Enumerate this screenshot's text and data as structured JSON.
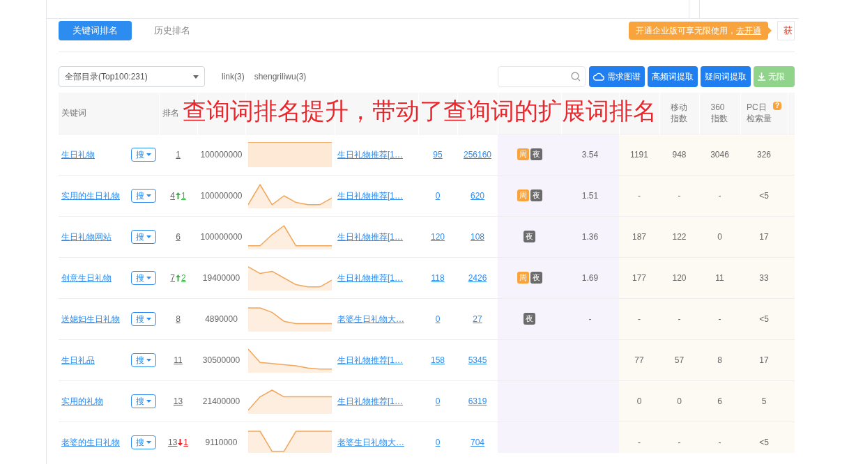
{
  "tabs": [
    {
      "label": "关键词排名",
      "selected": true
    },
    {
      "label": "历史排名",
      "selected": false
    }
  ],
  "promo": {
    "text": "开通企业版可享无限使用，",
    "link": "去开通"
  },
  "promo_side_button": "获",
  "category_select": "全部目录(Top100:231)",
  "filter_links": [
    "link(3)",
    "shengriliwu(3)"
  ],
  "toolbar_buttons": [
    {
      "label": "需求图谱",
      "kind": "graph"
    },
    {
      "label": "高频词提取",
      "kind": "plain"
    },
    {
      "label": "疑问词提取",
      "kind": "plain"
    },
    {
      "label": "无限",
      "kind": "download"
    }
  ],
  "header": {
    "keyword": "关键词",
    "rank": "排名",
    "mobile_index": "移动指数",
    "index_360": "360指数",
    "pc_daily": "PC日检索量",
    "pc_daily_help": "?"
  },
  "caption": "查询词排名提升，带动了查询词的扩展词排名",
  "rows": [
    {
      "keyword": "生日礼物",
      "search_button": "搜",
      "rank": "1",
      "index": "100000000",
      "title": "生日礼物推荐[1…",
      "column_6": "95",
      "column_7": "256160",
      "tags": [
        {
          "label": "周",
          "kind": "week"
        },
        {
          "label": "夜",
          "kind": "night"
        }
      ],
      "column_9": "3.54",
      "column_10": "1191",
      "mobile_index": "948",
      "index_360": "3046",
      "pc_daily": "326"
    },
    {
      "keyword": "实用的生日礼物",
      "search_button": "搜",
      "rank": "4",
      "rank_change": {
        "up": true,
        "value": "1"
      },
      "index": "100000000",
      "title": "生日礼物推荐[1…",
      "column_6": "0",
      "column_7": "620",
      "tags": [
        {
          "label": "周",
          "kind": "week"
        },
        {
          "label": "夜",
          "kind": "night"
        }
      ],
      "column_9": "1.51",
      "column_10": "-",
      "mobile_index": "-",
      "index_360": "-",
      "pc_daily": "<5"
    },
    {
      "keyword": "生日礼物网站",
      "search_button": "搜",
      "rank": "6",
      "index": "100000000",
      "title": "生日礼物推荐[1…",
      "column_6": "120",
      "column_7": "108",
      "tags": [
        {
          "label": "夜",
          "kind": "night"
        }
      ],
      "column_9": "1.36",
      "column_10": "187",
      "mobile_index": "122",
      "index_360": "0",
      "pc_daily": "17"
    },
    {
      "keyword": "创意生日礼物",
      "search_button": "搜",
      "rank": "7",
      "rank_change": {
        "up": true,
        "value": "2"
      },
      "index": "19400000",
      "title": "生日礼物推荐[1…",
      "column_6": "118",
      "column_7": "2426",
      "tags": [
        {
          "label": "周",
          "kind": "week"
        },
        {
          "label": "夜",
          "kind": "night"
        }
      ],
      "column_9": "1.69",
      "column_10": "177",
      "mobile_index": "120",
      "index_360": "11",
      "pc_daily": "33"
    },
    {
      "keyword": "送媳妇生日礼物",
      "search_button": "搜",
      "rank": "8",
      "index": "4890000",
      "title": "老婆生日礼物大…",
      "column_6": "0",
      "column_7": "27",
      "tags": [
        {
          "label": "夜",
          "kind": "night"
        }
      ],
      "column_9": "-",
      "column_10": "-",
      "mobile_index": "-",
      "index_360": "-",
      "pc_daily": "<5"
    },
    {
      "keyword": "生日礼品",
      "search_button": "搜",
      "rank": "11",
      "index": "30500000",
      "title": "生日礼物推荐[1…",
      "column_6": "158",
      "column_7": "5345",
      "column_10": "77",
      "mobile_index": "57",
      "index_360": "8",
      "pc_daily": "17"
    },
    {
      "keyword": "实用的礼物",
      "search_button": "搜",
      "rank": "13",
      "index": "21400000",
      "title": "生日礼物推荐[1…",
      "column_6": "0",
      "column_7": "6319",
      "column_10": "0",
      "mobile_index": "0",
      "index_360": "6",
      "pc_daily": "5"
    },
    {
      "keyword": "老婆的生日礼物",
      "search_button": "搜",
      "rank": "13",
      "rank_change": {
        "up": false,
        "value": "1"
      },
      "index": "9110000",
      "title": "老婆生日礼物大…",
      "column_6": "0",
      "column_7": "704",
      "column_10": "-",
      "mobile_index": "-",
      "index_360": "-",
      "pc_daily": "<5"
    }
  ]
}
